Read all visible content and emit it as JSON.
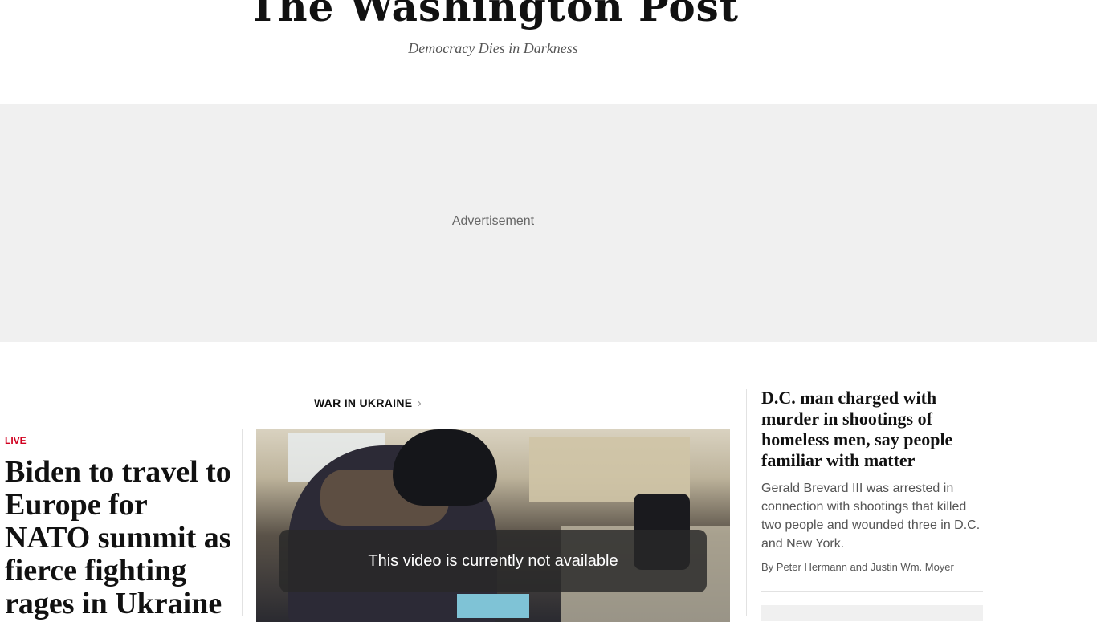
{
  "masthead": {
    "logo": "The Washington Post",
    "tagline": "Democracy Dies in Darkness"
  },
  "ad": {
    "label": "Advertisement"
  },
  "section": {
    "kicker": "WAR IN UKRAINE",
    "kicker_chevron": "›"
  },
  "lead_story": {
    "live_label": "LIVE",
    "headline": "Biden to travel to Europe for NATO summit as fierce fighting rages in Ukraine"
  },
  "video": {
    "message": "This video is currently not available"
  },
  "sidebar_story": {
    "headline": "D.C. man charged with murder in shootings of homeless men, say people familiar with matter",
    "blurb": "Gerald Brevard III was arrested in connection with shootings that killed two people and wounded three in D.C. and New York.",
    "byline": "By Peter Hermann and Justin Wm. Moyer"
  }
}
